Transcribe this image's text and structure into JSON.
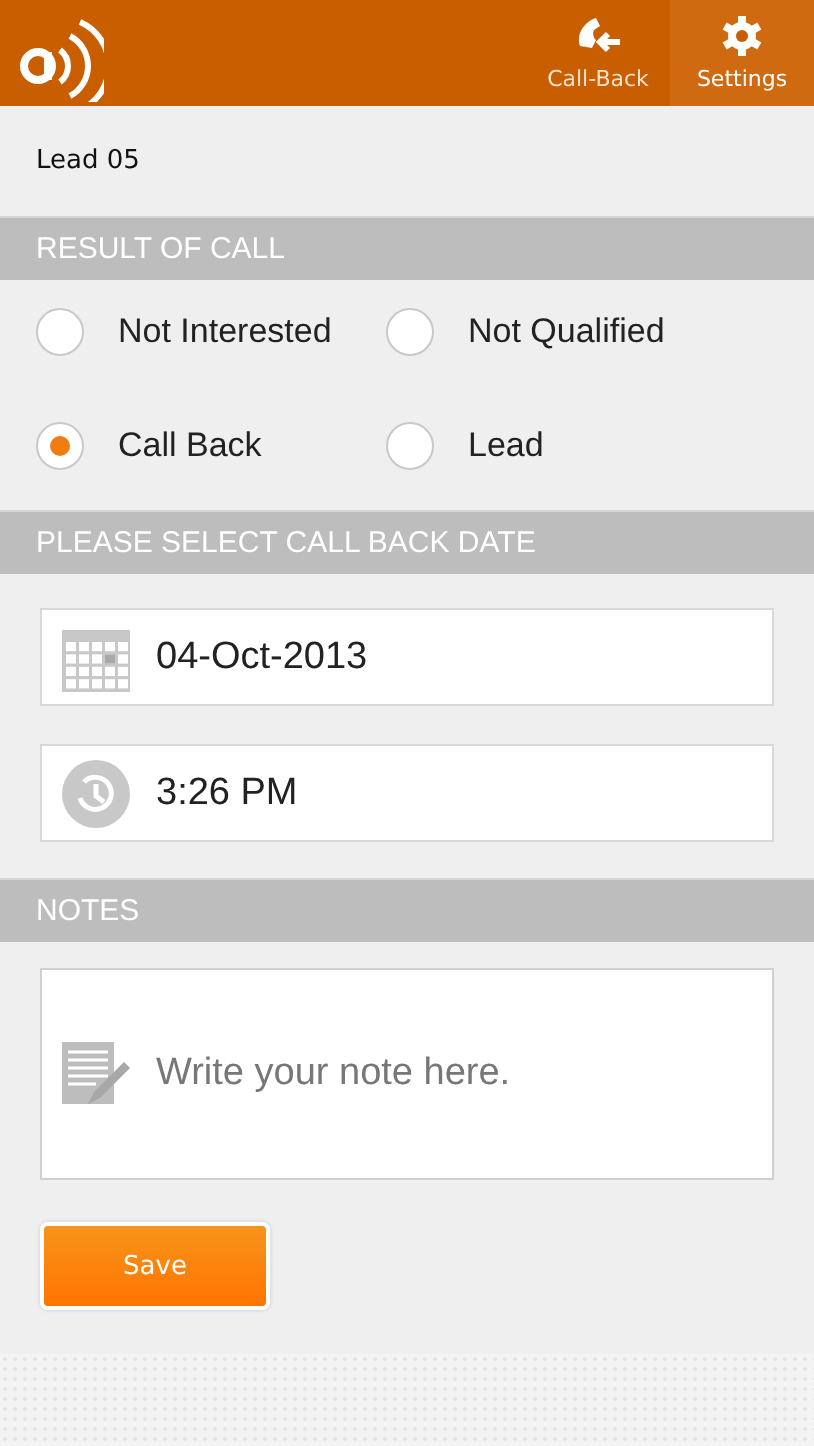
{
  "action_bar": {
    "actions": [
      {
        "kind": "callback",
        "label": "Call-Back",
        "selected": false
      },
      {
        "kind": "settings",
        "label": "Settings",
        "selected": true
      }
    ]
  },
  "lead_name": "Lead 05",
  "result_section": {
    "title": "RESULT OF CALL",
    "options": [
      {
        "label": "Not Interested",
        "selected": false
      },
      {
        "label": "Not Qualified",
        "selected": false
      },
      {
        "label": "Call Back",
        "selected": true
      },
      {
        "label": "Lead",
        "selected": false
      }
    ]
  },
  "callback_section": {
    "title": "PLEASE SELECT CALL BACK DATE",
    "fields": [
      {
        "kind": "date",
        "value": "04-Oct-2013"
      },
      {
        "kind": "time",
        "value": "3:26 PM"
      }
    ]
  },
  "notes_section": {
    "title": "NOTES",
    "placeholder": "Write your note here."
  },
  "save_button": "Save"
}
